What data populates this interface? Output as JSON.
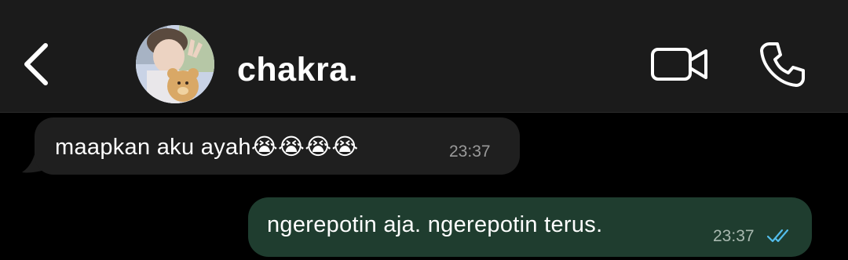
{
  "header": {
    "contact_name": "chakra.",
    "back_icon": "chevron-left-icon",
    "video_icon": "video-camera-icon",
    "call_icon": "phone-icon"
  },
  "messages": [
    {
      "direction": "incoming",
      "text": "maapkan aku ayah",
      "emoji": "😭😭😭😭",
      "time": "23:37"
    },
    {
      "direction": "outgoing",
      "text": "ngerepotin aja. ngerepotin terus.",
      "time": "23:37",
      "status": "read"
    }
  ],
  "colors": {
    "header_bg": "#1b1b1b",
    "chat_bg": "#000000",
    "incoming_bubble": "#1f1f1f",
    "outgoing_bubble": "#1f3d2f",
    "read_tick": "#53bdeb"
  }
}
